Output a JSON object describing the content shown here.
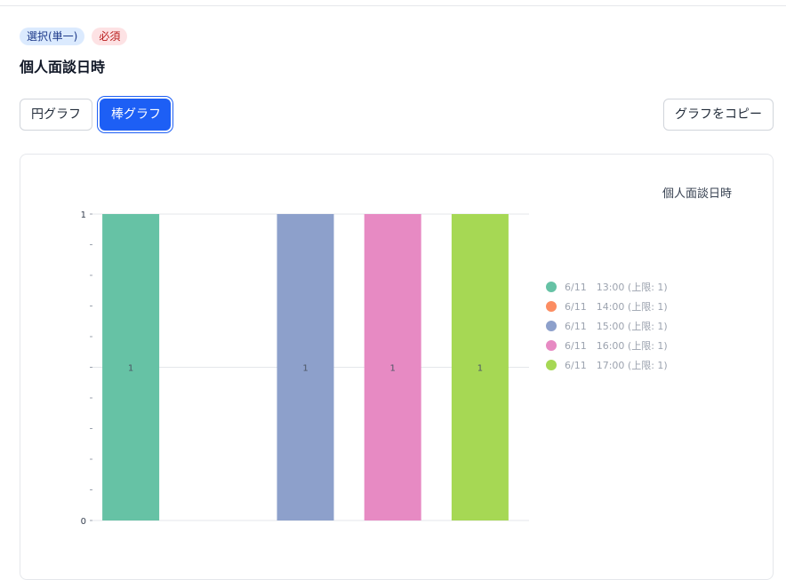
{
  "question": {
    "type_badge": "選択(単一)",
    "required_badge": "必須",
    "title": "個人面談日時"
  },
  "toolbar": {
    "pie_label": "円グラフ",
    "bar_label": "棒グラフ",
    "copy_label": "グラフをコピー",
    "active": "bar"
  },
  "colors": {
    "primary": "#1d5ff5",
    "series": [
      "#66c2a5",
      "#fc8d62",
      "#8da0cb",
      "#e78ac3",
      "#a6d854"
    ]
  },
  "chart_data": {
    "type": "bar",
    "title": "個人面談日時",
    "categories": [
      "6/11　13:00 (上限: 1)",
      "6/11　14:00 (上限: 1)",
      "6/11　15:00 (上限: 1)",
      "6/11　16:00 (上限: 1)",
      "6/11　17:00 (上限: 1)"
    ],
    "values": [
      1,
      0,
      1,
      1,
      1
    ],
    "ylim": [
      0,
      1
    ],
    "yticks": [
      "0",
      "1"
    ],
    "data_labels": [
      "1",
      "",
      "1",
      "1",
      "1"
    ],
    "legend": "right",
    "grid": true
  }
}
